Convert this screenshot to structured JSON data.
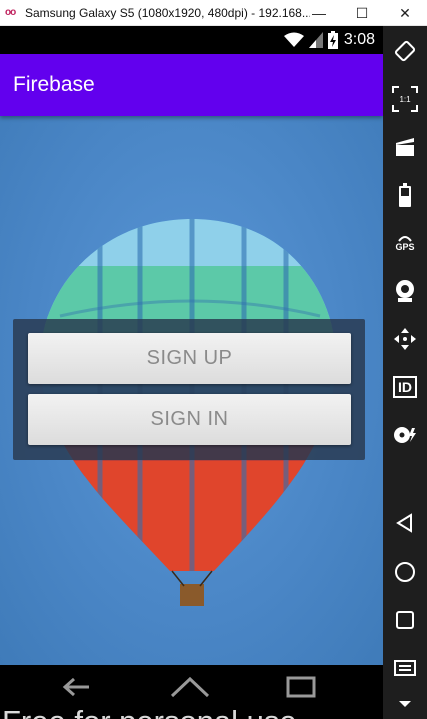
{
  "window": {
    "logo_text": "oo",
    "title": "Samsung Galaxy S5 (1080x1920, 480dpi) - 192.168...",
    "minimize": "—",
    "maximize": "☐",
    "close": "✕"
  },
  "status_bar": {
    "time": "3:08",
    "icons": [
      "wifi-icon",
      "signal-icon",
      "battery-icon"
    ]
  },
  "app_bar": {
    "title": "Firebase"
  },
  "main": {
    "sign_up_label": "SIGN UP",
    "sign_in_label": "SIGN IN",
    "background_image": "hot-air-balloon"
  },
  "watermark": {
    "text": "Free for personal use"
  },
  "toolbar": {
    "items": [
      "rotate-icon",
      "fullscreen-icon",
      "video-capture-icon",
      "battery-icon",
      "gps-icon",
      "camera-icon",
      "move-icon",
      "id-icon",
      "disk-icon",
      "back-icon",
      "home-icon",
      "recents-icon",
      "menu-icon",
      "expand-down-icon"
    ],
    "scale_label": "1:1",
    "gps_label": "GPS",
    "id_label": "ID"
  },
  "colors": {
    "app_bar": "#6200ee",
    "screen_bg": "#4a86c6",
    "panel": "#28384e",
    "button": "#e6e6e6",
    "button_text": "#8a8a8a",
    "toolbar": "#1e1e1e"
  }
}
